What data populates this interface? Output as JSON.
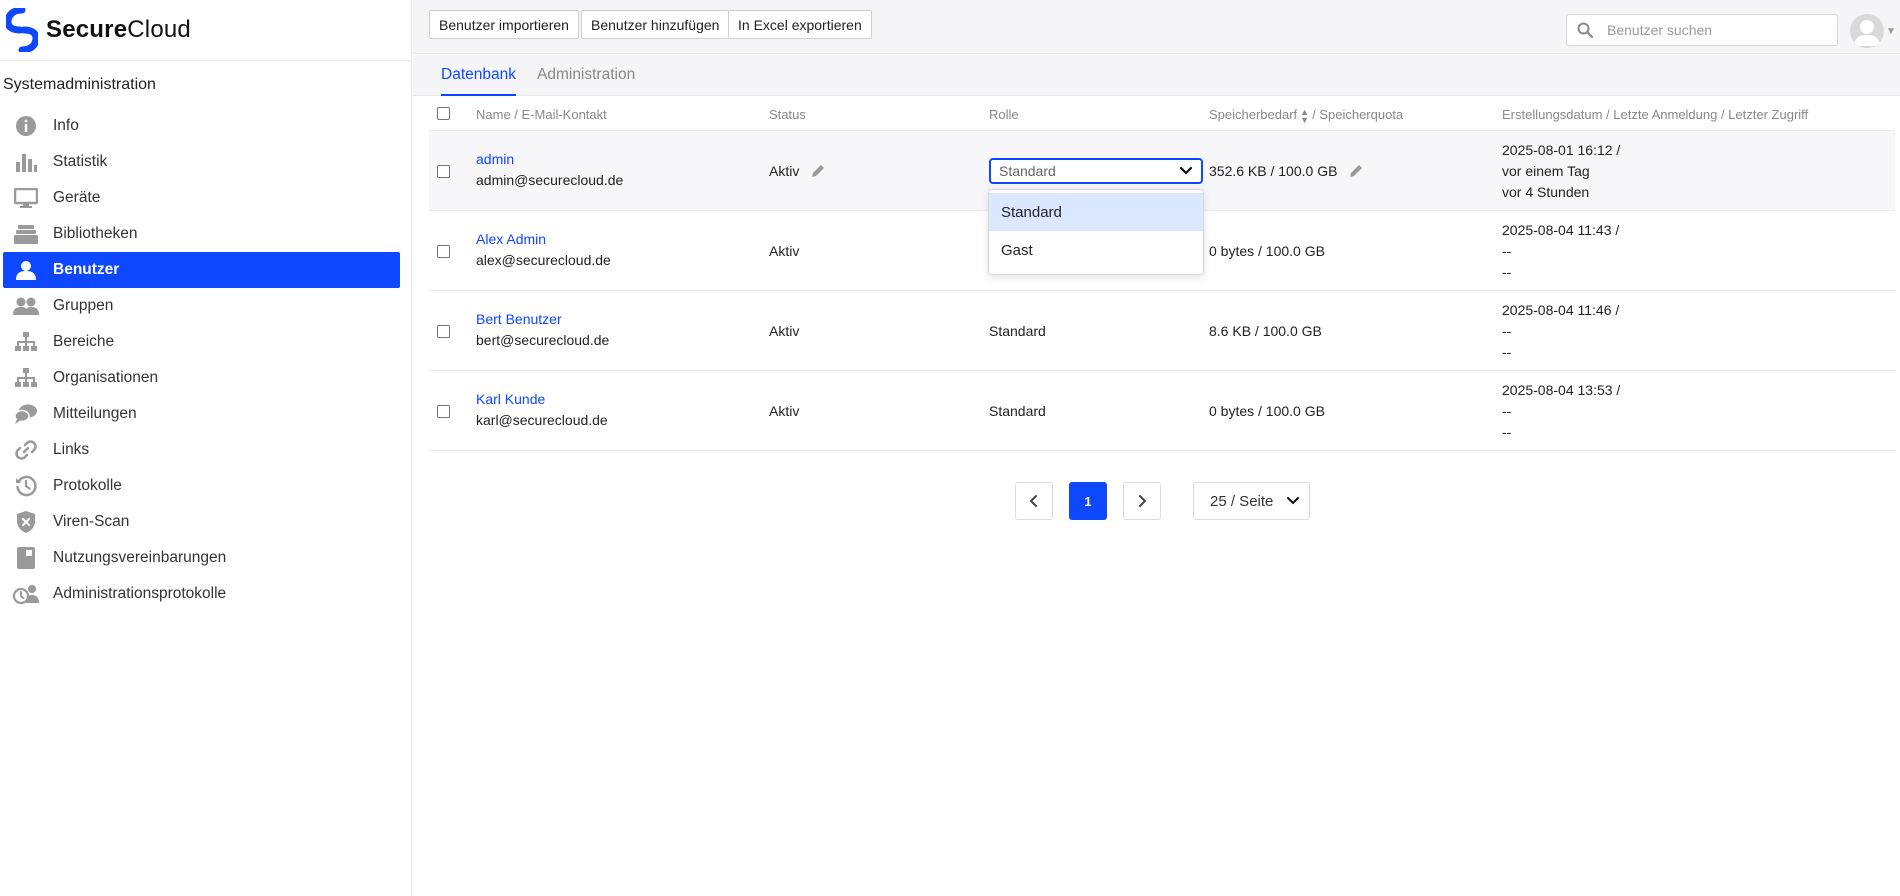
{
  "app": {
    "logo_first": "Secure",
    "logo_second": "Cloud",
    "brand_color": "#0d47ff"
  },
  "sidebar": {
    "title": "Systemadministration",
    "items": [
      {
        "label": "Info",
        "icon": "info-icon",
        "active": false
      },
      {
        "label": "Statistik",
        "icon": "bar-chart-icon",
        "active": false
      },
      {
        "label": "Geräte",
        "icon": "monitor-icon",
        "active": false
      },
      {
        "label": "Bibliotheken",
        "icon": "library-icon",
        "active": false
      },
      {
        "label": "Benutzer",
        "icon": "user-icon",
        "active": true
      },
      {
        "label": "Gruppen",
        "icon": "group-icon",
        "active": false
      },
      {
        "label": "Bereiche",
        "icon": "sitemap-icon",
        "active": false
      },
      {
        "label": "Organisationen",
        "icon": "organization-icon",
        "active": false
      },
      {
        "label": "Mitteilungen",
        "icon": "chat-icon",
        "active": false
      },
      {
        "label": "Links",
        "icon": "link-icon",
        "active": false
      },
      {
        "label": "Protokolle",
        "icon": "history-icon",
        "active": false
      },
      {
        "label": "Viren-Scan",
        "icon": "shield-icon",
        "active": false
      },
      {
        "label": "Nutzungsvereinbarungen",
        "icon": "document-icon",
        "active": false
      },
      {
        "label": "Administrationsprotokolle",
        "icon": "admin-log-icon",
        "active": false
      }
    ]
  },
  "toolbar": {
    "import_label": "Benutzer importieren",
    "add_label": "Benutzer hinzufügen",
    "export_label": "In Excel exportieren",
    "search_placeholder": "Benutzer suchen"
  },
  "tabs": [
    {
      "label": "Datenbank",
      "active": true
    },
    {
      "label": "Administration",
      "active": false
    }
  ],
  "table": {
    "columns": {
      "name": "Name / E-Mail-Kontakt",
      "status": "Status",
      "role": "Rolle",
      "storage_a": "Speicherbedarf",
      "storage_b": "/ Speicherquota",
      "dates": "Erstellungsdatum / Letzte Anmeldung / Letzter Zugriff"
    },
    "rows": [
      {
        "name": "admin",
        "email": "admin@securecloud.de",
        "status": "Aktiv",
        "role": "Standard",
        "storage": "352.6 KB / 100.0 GB",
        "created": "2025-08-01 16:12 /",
        "last_login": "vor einem Tag",
        "last_access": "vor 4 Stunden"
      },
      {
        "name": "Alex Admin",
        "email": "alex@securecloud.de",
        "status": "Aktiv",
        "role": "",
        "storage": "0 bytes / 100.0 GB",
        "created": "2025-08-04 11:43 /",
        "last_login": "--",
        "last_access": "--"
      },
      {
        "name": "Bert Benutzer",
        "email": "bert@securecloud.de",
        "status": "Aktiv",
        "role": "Standard",
        "storage": "8.6 KB / 100.0 GB",
        "created": "2025-08-04 11:46 /",
        "last_login": "--",
        "last_access": "--"
      },
      {
        "name": "Karl Kunde",
        "email": "karl@securecloud.de",
        "status": "Aktiv",
        "role": "Standard",
        "storage": "0 bytes / 100.0 GB",
        "created": "2025-08-04 13:53 /",
        "last_login": "--",
        "last_access": "--"
      }
    ]
  },
  "role_dropdown": {
    "options": [
      "Standard",
      "Gast"
    ],
    "selected": "Standard"
  },
  "pagination": {
    "current_page": "1",
    "per_page": "25 / Seite"
  }
}
